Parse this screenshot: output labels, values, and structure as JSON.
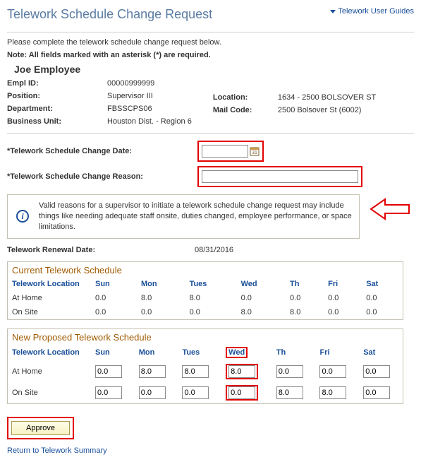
{
  "header": {
    "title": "Telework Schedule Change Request",
    "guides_link": "Telework User Guides"
  },
  "instructions": {
    "line1": "Please complete the telework schedule change request below.",
    "line2": "Note: All fields marked with an asterisk (*) are required."
  },
  "employee": {
    "name": "Joe Employee",
    "empl_id_label": "Empl ID:",
    "empl_id": "00000999999",
    "position_label": "Position:",
    "position": "Supervisor III",
    "department_label": "Department:",
    "department": "FBSSCPS06",
    "business_unit_label": "Business Unit:",
    "business_unit": "Houston Dist. - Region 6",
    "location_label": "Location:",
    "location": "1634 - 2500 BOLSOVER ST",
    "mail_code_label": "Mail Code:",
    "mail_code": "2500 Bolsover St (6002)"
  },
  "form": {
    "change_date_label": "*Telework Schedule Change Date:",
    "change_date_value": "",
    "change_reason_label": "*Telework Schedule Change Reason:",
    "change_reason_value": ""
  },
  "info_box": {
    "text": "Valid reasons for a supervisor to initiate a telework schedule change request may include things like needing adequate staff onsite, duties changed, employee performance, or space limitations."
  },
  "renewal": {
    "label": "Telework Renewal Date:",
    "value": "08/31/2016"
  },
  "columns": [
    "Sun",
    "Mon",
    "Tues",
    "Wed",
    "Th",
    "Fri",
    "Sat"
  ],
  "current_schedule": {
    "title": "Current Telework Schedule",
    "loc_header": "Telework Location",
    "rows": [
      {
        "loc": "At Home",
        "vals": [
          "0.0",
          "8.0",
          "8.0",
          "0.0",
          "0.0",
          "0.0",
          "0.0"
        ]
      },
      {
        "loc": "On Site",
        "vals": [
          "0.0",
          "0.0",
          "0.0",
          "8.0",
          "8.0",
          "0.0",
          "0.0"
        ]
      }
    ]
  },
  "proposed_schedule": {
    "title": "New Proposed Telework Schedule",
    "loc_header": "Telework Location",
    "rows": [
      {
        "loc": "At Home",
        "vals": [
          "0.0",
          "8.0",
          "8.0",
          "8.0",
          "0.0",
          "0.0",
          "0.0"
        ]
      },
      {
        "loc": "On Site",
        "vals": [
          "0.0",
          "0.0",
          "0.0",
          "0.0",
          "8.0",
          "8.0",
          "0.0"
        ]
      }
    ]
  },
  "actions": {
    "approve_label": "Approve",
    "return_link": "Return to Telework Summary"
  }
}
